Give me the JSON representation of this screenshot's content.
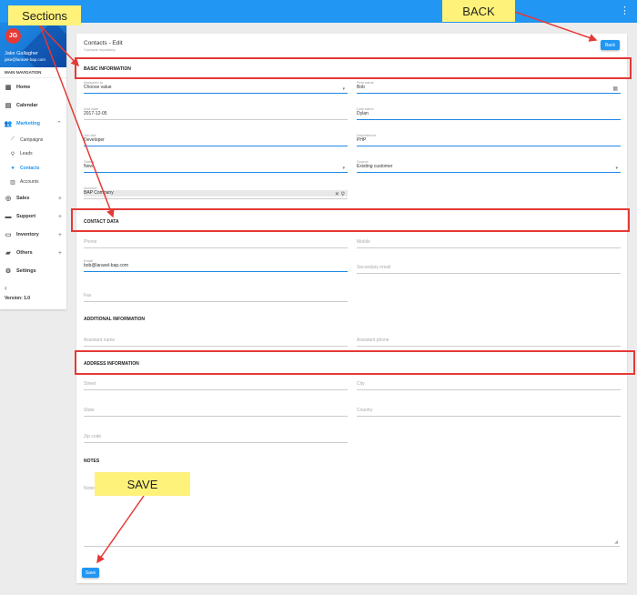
{
  "sidebar": {
    "avatar_initials": "JG",
    "user_name": "Jake Gallagher",
    "user_email": "jake@laravel-bap.com",
    "section_label": "MAIN NAVIGATION",
    "items": [
      {
        "label": "Home",
        "icon": "grid-icon"
      },
      {
        "label": "Calendar",
        "icon": "calendar-icon"
      },
      {
        "label": "Marketing",
        "icon": "people-icon",
        "expanded": true
      },
      {
        "label": "Campaigns",
        "icon": "trend-icon"
      },
      {
        "label": "Leads",
        "icon": "search-icon"
      },
      {
        "label": "Contacts",
        "icon": "person-icon",
        "active": true
      },
      {
        "label": "Accounts",
        "icon": "building-icon"
      },
      {
        "label": "Sales",
        "icon": "target-icon",
        "plus": "+"
      },
      {
        "label": "Support",
        "icon": "support-icon",
        "plus": "+"
      },
      {
        "label": "Inventory",
        "icon": "laptop-icon",
        "plus": "+"
      },
      {
        "label": "Others",
        "icon": "others-icon",
        "plus": "+"
      },
      {
        "label": "Settings",
        "icon": "gear-icon"
      }
    ],
    "collapse_glyph": "‹",
    "version": "Version: 1.0"
  },
  "panel": {
    "title": "Contacts - Edit",
    "subtitle": "Contacts repository",
    "back_label": "Back",
    "save_label": "Save"
  },
  "sections": {
    "basic": "BASIC INFORMATION",
    "contact": "CONTACT DATA",
    "additional": "ADDITIONAL INFORMATION",
    "address": "ADDRESS INFORMATION",
    "notes": "NOTES"
  },
  "fields": {
    "assigned_to": {
      "label": "Assigned to",
      "value": "Choose value"
    },
    "first_name": {
      "label": "First name",
      "value": "Bob"
    },
    "add_date": {
      "label": "Add date",
      "value": "2017-12-05"
    },
    "last_name": {
      "label": "Last name",
      "value": "Dylan"
    },
    "job_title": {
      "label": "Job title",
      "value": "Developer"
    },
    "department": {
      "label": "Department",
      "value": "PHP"
    },
    "status": {
      "label": "Status",
      "value": "New"
    },
    "source": {
      "label": "Source",
      "value": "Existing customer"
    },
    "account": {
      "label": "Account",
      "value": "BAP Company"
    },
    "phone": {
      "placeholder": "Phone"
    },
    "mobile": {
      "placeholder": "Mobile"
    },
    "email": {
      "label": "Email",
      "value": "bob@laravel-bap.com"
    },
    "secondary_email": {
      "placeholder": "Secondary email"
    },
    "fax": {
      "placeholder": "Fax"
    },
    "assistant_name": {
      "placeholder": "Assistant name"
    },
    "assistant_phone": {
      "placeholder": "Assistant phone"
    },
    "street": {
      "placeholder": "Street"
    },
    "city": {
      "placeholder": "City"
    },
    "state": {
      "placeholder": "State"
    },
    "country": {
      "placeholder": "Country"
    },
    "zip_code": {
      "placeholder": "Zip code"
    },
    "notes": {
      "placeholder": "Notes"
    }
  },
  "annotations": {
    "sections_label": "Sections",
    "back_label": "BACK",
    "save_label": "SAVE",
    "highlight_color": "#e53935",
    "callout_color": "#fff27a"
  },
  "colors": {
    "primary": "#2196f3",
    "background": "#ececec"
  }
}
